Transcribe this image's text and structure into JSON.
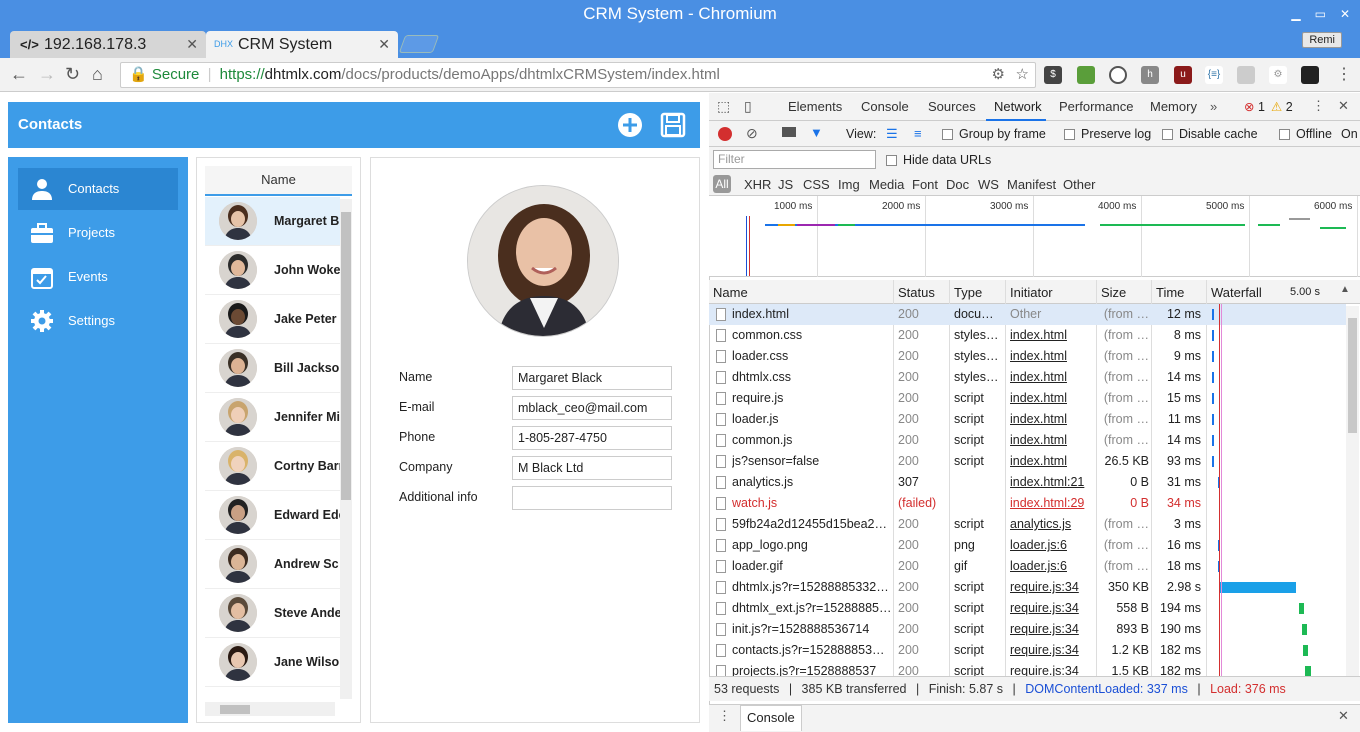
{
  "window": {
    "title": "CRM System - Chromium"
  },
  "tabs": [
    {
      "label": "192.168.178.3",
      "icon": "code-icon"
    },
    {
      "label": "CRM System",
      "icon": "dhx-icon"
    }
  ],
  "user_badge": "Remi",
  "address": {
    "secure_label": "Secure",
    "url_scheme": "https://",
    "url_host": "dhtmlx.com",
    "url_path": "/docs/products/demoApps/dhtmlxCRMSystem/index.html"
  },
  "app": {
    "header_title": "Contacts",
    "sidebar": [
      {
        "label": "Contacts",
        "icon": "user-icon",
        "active": true
      },
      {
        "label": "Projects",
        "icon": "briefcase-icon",
        "active": false
      },
      {
        "label": "Events",
        "icon": "calendar-icon",
        "active": false
      },
      {
        "label": "Settings",
        "icon": "gear-icon",
        "active": false
      }
    ],
    "grid_header": "Name",
    "contacts": [
      "Margaret B",
      "John Woke",
      "Jake Peter",
      "Bill Jackso",
      "Jennifer Mi",
      "Cortny Barr",
      "Edward Ede",
      "Andrew Sc",
      "Steve Ande",
      "Jane Wilso"
    ],
    "form": [
      {
        "label": "Name",
        "value": "Margaret Black"
      },
      {
        "label": "E-mail",
        "value": "mblack_ceo@mail.com"
      },
      {
        "label": "Phone",
        "value": "1-805-287-4750"
      },
      {
        "label": "Company",
        "value": "M Black Ltd"
      },
      {
        "label": "Additional info",
        "value": ""
      }
    ]
  },
  "devtools": {
    "tabs": [
      "Elements",
      "Console",
      "Sources",
      "Network",
      "Performance",
      "Memory"
    ],
    "active_tab": "Network",
    "errors": "1",
    "warnings": "2",
    "toolbar": {
      "view": "View:",
      "group": "Group by frame",
      "preserve": "Preserve log",
      "cache": "Disable cache",
      "offline": "Offline",
      "online": "On"
    },
    "filter_placeholder": "Filter",
    "hide_data": "Hide data URLs",
    "types": [
      "All",
      "XHR",
      "JS",
      "CSS",
      "Img",
      "Media",
      "Font",
      "Doc",
      "WS",
      "Manifest",
      "Other"
    ],
    "overview_ticks": [
      "1000 ms",
      "2000 ms",
      "3000 ms",
      "4000 ms",
      "5000 ms",
      "6000 ms"
    ],
    "columns": [
      "Name",
      "Status",
      "Type",
      "Initiator",
      "Size",
      "Time",
      "Waterfall"
    ],
    "waterfall_scale": "5.00 s",
    "requests": [
      {
        "name": "index.html",
        "status": "200",
        "type": "docu…",
        "initiator": "Other",
        "size": "(from …",
        "time": "12 ms",
        "w": [
          0.0,
          0.005
        ]
      },
      {
        "name": "common.css",
        "status": "200",
        "type": "styles…",
        "initiator": "index.html",
        "size": "(from …",
        "time": "8 ms",
        "w": [
          0.0,
          0.005
        ]
      },
      {
        "name": "loader.css",
        "status": "200",
        "type": "styles…",
        "initiator": "index.html",
        "size": "(from …",
        "time": "9 ms",
        "w": [
          0.0,
          0.005
        ]
      },
      {
        "name": "dhtmlx.css",
        "status": "200",
        "type": "styles…",
        "initiator": "index.html",
        "size": "(from …",
        "time": "14 ms",
        "w": [
          0.0,
          0.005
        ]
      },
      {
        "name": "require.js",
        "status": "200",
        "type": "script",
        "initiator": "index.html",
        "size": "(from …",
        "time": "15 ms",
        "w": [
          0.0,
          0.005
        ]
      },
      {
        "name": "loader.js",
        "status": "200",
        "type": "script",
        "initiator": "index.html",
        "size": "(from …",
        "time": "11 ms",
        "w": [
          0.0,
          0.005
        ]
      },
      {
        "name": "common.js",
        "status": "200",
        "type": "script",
        "initiator": "index.html",
        "size": "(from …",
        "time": "14 ms",
        "w": [
          0.0,
          0.005
        ]
      },
      {
        "name": "js?sensor=false",
        "status": "200",
        "type": "script",
        "initiator": "index.html",
        "size": "26.5 KB",
        "time": "93 ms",
        "w": [
          0.0,
          0.016
        ]
      },
      {
        "name": "analytics.js",
        "status": "307",
        "type": "",
        "initiator": "index.html:21",
        "size": "0 B",
        "time": "31 ms",
        "w": [
          0.05,
          0.006
        ]
      },
      {
        "name": "watch.js",
        "status": "(failed)",
        "type": "",
        "initiator": "index.html:29",
        "size": "0 B",
        "time": "34 ms",
        "w": [
          0.05,
          0.0
        ],
        "failed": true
      },
      {
        "name": "59fb24a2d12455d15bea2…",
        "status": "200",
        "type": "script",
        "initiator": "analytics.js",
        "size": "(from …",
        "time": "3 ms",
        "w": [
          0.05,
          0.0
        ]
      },
      {
        "name": "app_logo.png",
        "status": "200",
        "type": "png",
        "initiator": "loader.js:6",
        "size": "(from …",
        "time": "16 ms",
        "w": [
          0.05,
          0.004
        ]
      },
      {
        "name": "loader.gif",
        "status": "200",
        "type": "gif",
        "initiator": "loader.js:6",
        "size": "(from …",
        "time": "18 ms",
        "w": [
          0.05,
          0.004
        ]
      },
      {
        "name": "dhtmlx.js?r=15288885332…",
        "status": "200",
        "type": "script",
        "initiator": "require.js:34",
        "size": "350 KB",
        "time": "2.98 s",
        "w": [
          0.06,
          0.6
        ]
      },
      {
        "name": "dhtmlx_ext.js?r=15288885…",
        "status": "200",
        "type": "script",
        "initiator": "require.js:34",
        "size": "558 B",
        "time": "194 ms",
        "w": [
          0.68,
          0.04
        ]
      },
      {
        "name": "init.js?r=1528888536714",
        "status": "200",
        "type": "script",
        "initiator": "require.js:34",
        "size": "893 B",
        "time": "190 ms",
        "w": [
          0.7,
          0.04
        ]
      },
      {
        "name": "contacts.js?r=152888853…",
        "status": "200",
        "type": "script",
        "initiator": "require.js:34",
        "size": "1.2 KB",
        "time": "182 ms",
        "w": [
          0.71,
          0.04
        ]
      },
      {
        "name": "projects.js?r=1528888537",
        "status": "200",
        "type": "script",
        "initiator": "require.js:34",
        "size": "1.5 KB",
        "time": "182 ms",
        "w": [
          0.73,
          0.04
        ]
      }
    ],
    "summary": {
      "requests": "53 requests",
      "transferred": "385 KB transferred",
      "finish": "Finish: 5.87 s",
      "dcl": "DOMContentLoaded: 337 ms",
      "load": "Load: 376 ms"
    },
    "drawer": "Console"
  },
  "colors": {
    "chrome_blue": "#4a8fe3",
    "app_blue": "#3d9ce8",
    "accent": "#1a73e8",
    "error": "#d32f2f"
  }
}
